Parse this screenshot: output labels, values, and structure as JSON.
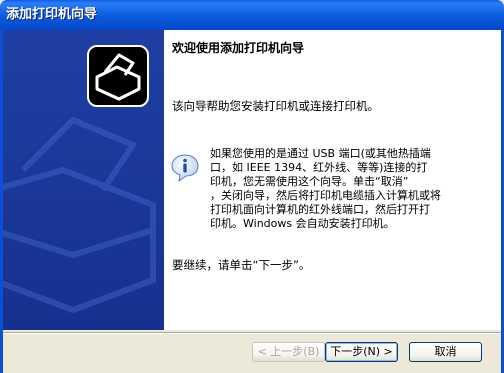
{
  "window": {
    "title": "添加打印机向导"
  },
  "wizard": {
    "heading": "欢迎使用添加打印机向导",
    "intro": "该向导帮助您安装打印机或连接打印机。",
    "info_lines": [
      "如果您使用的是通过 USB 端口(或其他热插端",
      "口，如 IEEE 1394、红外线、等等)连接的打",
      "印机，您无需使用这个向导。单击“取消”",
      "，关闭向导，然后将打印机电缆插入计算机或将",
      "打印机面向计算机的红外线端口，然后打开打",
      "印机。Windows 会自动安装打印机。"
    ],
    "continue_text": "要继续，请单击“下一步”。"
  },
  "buttons": {
    "back": "< 上一步(B)",
    "next": "下一步(N) >",
    "cancel": "取消"
  },
  "icons": {
    "sidebar": "printer-wizard-icon",
    "info": "info-icon"
  },
  "colors": {
    "titlebar": "#0a5fe8",
    "sidebar": "#1f3fa4",
    "face": "#ece9d8"
  }
}
